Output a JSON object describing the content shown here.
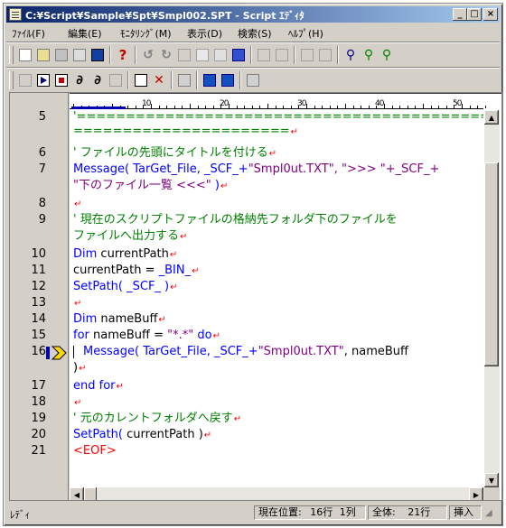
{
  "window": {
    "title": "C:¥Script¥Sample¥Spt¥Smpl002.SPT - Script ｴﾃﾞｨﾀ",
    "controls": {
      "minimize": "_",
      "maximize": "□",
      "close": "×"
    }
  },
  "menu": [
    {
      "label": "ﾌｧｲﾙ(F)"
    },
    {
      "label": "編集(E)"
    },
    {
      "label": "ﾓﾆﾀﾘﾝｸﾞ(M)"
    },
    {
      "label": "表示(D)"
    },
    {
      "label": "検索(S)"
    },
    {
      "label": "ﾍﾙﾌﾟ(H)"
    }
  ],
  "ruler": {
    "marks": [
      "10",
      "20",
      "30",
      "40",
      "50"
    ]
  },
  "editor": {
    "lines": [
      {
        "num": "5",
        "text": "'======================================================"
      },
      {
        "num": "",
        "text": "======================"
      },
      {
        "num": "6",
        "text": "' ファイルの先頭にタイトルを付ける"
      },
      {
        "num": "7",
        "a": "Message(",
        "b": " TarGet_File, _SCF_+",
        "c": "\"Smpl0ut.TXT\"",
        "d": ", \">>> \"+_SCF_+"
      },
      {
        "num": "",
        "a": "\"下のファイル一覧 <<<\"",
        "b": " )"
      },
      {
        "num": "8",
        "text": ""
      },
      {
        "num": "9",
        "text": "' 現在のスクリプトファイルの格納先フォルダ下のファイルを"
      },
      {
        "num": "",
        "text": "ファイルへ出力する"
      },
      {
        "num": "10",
        "kw": "Dim",
        "rest": " currentPath"
      },
      {
        "num": "11",
        "rest": "currentPath = ",
        "var": "_BIN_"
      },
      {
        "num": "12",
        "kw": "SetPath(",
        "var": " _SCF_ )"
      },
      {
        "num": "13",
        "text": ""
      },
      {
        "num": "14",
        "kw": "Dim",
        "rest": " nameBuff"
      },
      {
        "num": "15",
        "kw": "for",
        "rest": " nameBuff = ",
        "str": "\"*.*\"",
        "kw2": " do"
      },
      {
        "num": "16",
        "kw": "Message(",
        "var": " TarGet_File, _SCF_+",
        "str": "\"Smpl0ut.TXT\"",
        "rest": ", nameBuff"
      },
      {
        "num": "",
        "text": ")"
      },
      {
        "num": "17",
        "kw": "end for"
      },
      {
        "num": "18",
        "text": ""
      },
      {
        "num": "19",
        "text": "' 元のカレントフォルダへ戻す"
      },
      {
        "num": "20",
        "kw": "SetPath(",
        "rest": " currentPath )"
      },
      {
        "num": "21",
        "eof": "<EOF>"
      }
    ]
  },
  "status": {
    "mode": "ﾚﾃﾞｨ",
    "position_label": "現在位置:",
    "position_line": "16行",
    "position_col": "1列",
    "total_label": "全体:",
    "total_lines": "21行",
    "insert": "挿入"
  },
  "colors": {
    "comment": "#008000",
    "keyword": "#0000ff",
    "string": "#800080",
    "return_mark": "#ff0000",
    "title_bar": "#0a246a"
  },
  "icons": {
    "toolbar1": [
      "new-icon",
      "open-icon",
      "save-icon",
      "print-icon",
      "book-icon",
      "help-icon",
      "undo-icon",
      "redo-icon",
      "cut-icon",
      "copy-icon",
      "paste-icon",
      "macro-icon",
      "find-icon",
      "replace-icon",
      "grid-icon",
      "sheet-icon",
      "zoom-icon",
      "find-next-icon",
      "find-prev-icon"
    ],
    "toolbar2": [
      "step-icon",
      "run-icon",
      "stop-icon",
      "debug-icon",
      "debug-step-icon",
      "watch-icon",
      "breakpoint-icon",
      "clear-breakpoint-icon",
      "trace-icon",
      "window1-icon",
      "window2-icon",
      "jump-icon"
    ]
  }
}
